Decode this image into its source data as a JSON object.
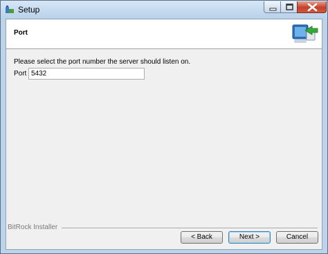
{
  "window": {
    "title": "Setup"
  },
  "header": {
    "title": "Port",
    "logo_icon": "monitor-install-icon"
  },
  "content": {
    "instruction": "Please select the port number the server should listen on.",
    "port_label": "Port",
    "port_value": "5432"
  },
  "footer": {
    "brand": "BitRock Installer"
  },
  "buttons": {
    "back": "< Back",
    "next": "Next >",
    "cancel": "Cancel"
  },
  "colors": {
    "title_bar": "#b9d1ea",
    "dialog_bg": "#f0f0f0",
    "close_button": "#c4412a",
    "default_button_border": "#3c7fb1"
  }
}
